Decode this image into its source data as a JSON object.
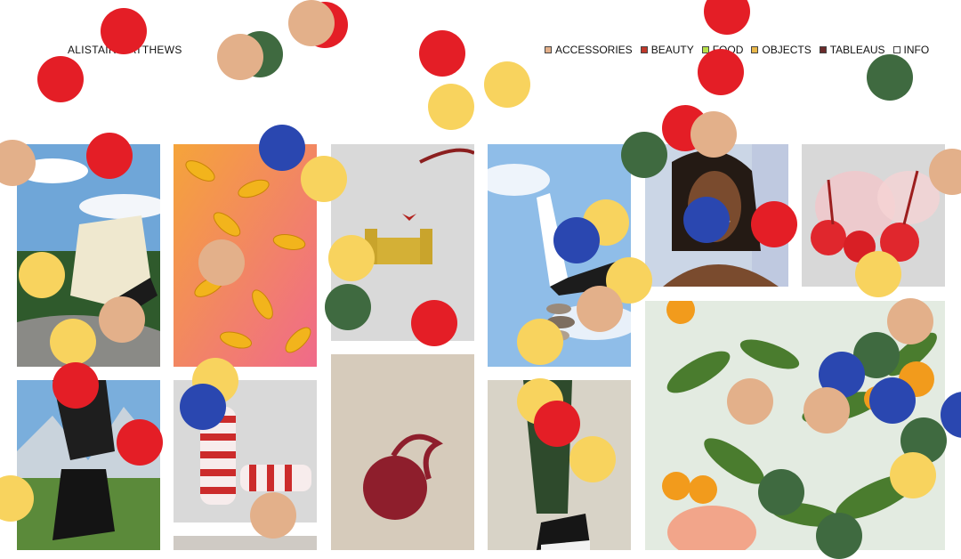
{
  "header": {
    "logo_text": "ALISTAIR MATTHEWS",
    "nav": [
      {
        "label": "ACCESSORIES",
        "swatch": "#e3b08a"
      },
      {
        "label": "BEAUTY",
        "swatch": "#c0392b"
      },
      {
        "label": "FOOD",
        "swatch": "#b7e04a"
      },
      {
        "label": "OBJECTS",
        "swatch": "#e9b84b"
      },
      {
        "label": "TABLEAUS",
        "swatch": "#6b2b2b"
      },
      {
        "label": "INFO",
        "swatch": "#ffffff"
      }
    ]
  },
  "colors": {
    "red": "#e41e26",
    "yellow": "#f8d35e",
    "peach": "#e3b08a",
    "green": "#3f6a40",
    "blue": "#2a47b0"
  },
  "gallery": [
    {
      "name": "boot-on-rock-sky"
    },
    {
      "name": "golden-capsules-pink"
    },
    {
      "name": "butterfly-on-yellow-sofa"
    },
    {
      "name": "shoe-balanced-stones-sky"
    },
    {
      "name": "smiling-woman-portrait"
    },
    {
      "name": "red-candy-apples"
    },
    {
      "name": "boot-mountain-landscape"
    },
    {
      "name": "candy-cane-rings"
    },
    {
      "name": "red-onion"
    },
    {
      "name": "green-trouser-sneaker"
    },
    {
      "name": "tomato-plant-citrus"
    }
  ]
}
